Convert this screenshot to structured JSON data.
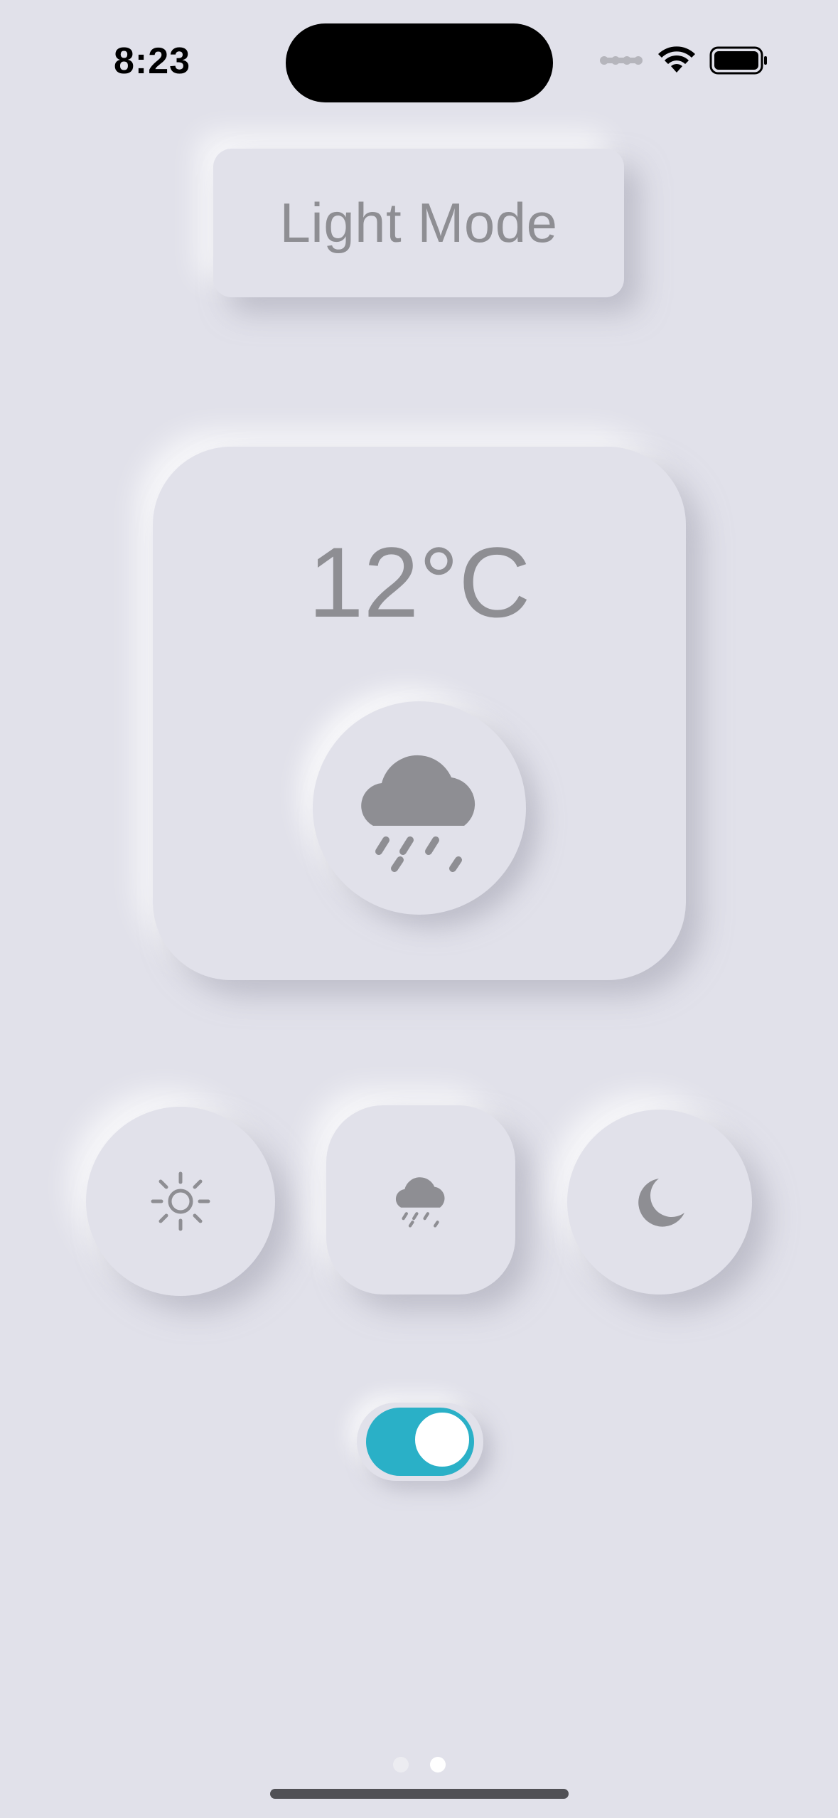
{
  "status_bar": {
    "time": "8:23",
    "icons": [
      "signal-dots-icon",
      "wifi-icon",
      "battery-icon"
    ]
  },
  "header": {
    "mode_label": "Light Mode"
  },
  "weather": {
    "temperature": "12°C",
    "icon": "cloud-rain-icon"
  },
  "mode_buttons": [
    {
      "name": "sun",
      "icon": "sun-icon"
    },
    {
      "name": "rain",
      "icon": "cloud-rain-icon",
      "selected": true
    },
    {
      "name": "moon",
      "icon": "moon-icon"
    }
  ],
  "toggle": {
    "on": true,
    "color": "#2ab0c7"
  },
  "page_indicator": {
    "pages": 2,
    "current": 2
  },
  "colors": {
    "background": "#e1e1ea",
    "text_gray": "#8e8e93",
    "accent": "#2ab0c7"
  }
}
